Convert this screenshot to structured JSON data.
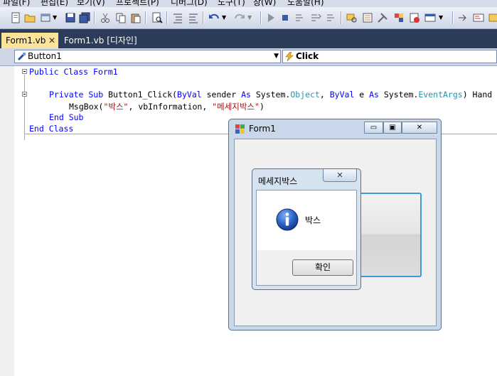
{
  "menu": {
    "items": [
      {
        "label": "파일(F)"
      },
      {
        "label": "편집(E)"
      },
      {
        "label": "보기(V)"
      },
      {
        "label": "프로젝트(P)"
      },
      {
        "label": "디버그(D)"
      },
      {
        "label": "도구(T)"
      },
      {
        "label": "창(W)"
      },
      {
        "label": "도움말(H)"
      }
    ]
  },
  "tabs": [
    {
      "label": "Form1.vb",
      "active": true
    },
    {
      "label": "Form1.vb [디자인]",
      "active": false
    }
  ],
  "dropdowns": {
    "object": "Button1",
    "event": "Click"
  },
  "code": {
    "line1": {
      "kw": "Public Class",
      "name": "Form1"
    },
    "line3": {
      "kw1": "Private Sub",
      "sig": "Button1_Click(",
      "byval1": "ByVal",
      "sender": " sender ",
      "as1": "As",
      "sys1": " System.",
      "type1": "Object",
      "comma": ", ",
      "byval2": "ByVal",
      "e": " e ",
      "as2": "As",
      "sys2": " System.",
      "type2": "EventArgs",
      "rest": ") Hand"
    },
    "line4": {
      "fn": "MsgBox(",
      "str1": "\"박스\"",
      "mid": ", vbInformation, ",
      "str2": "\"메세지박스\"",
      "end": ")"
    },
    "line5": "End Sub",
    "line6": "End Class"
  },
  "form1": {
    "title": "Form1",
    "minimize": "▭",
    "maximize": "▣",
    "close": "✕"
  },
  "msgbox": {
    "title": "메세지박스",
    "message": "박스",
    "ok_label": "확인",
    "close": "✕"
  },
  "colors": {
    "tab_active": "#fbe398",
    "tab_strip": "#2b3c59",
    "keyword": "#0000ff",
    "string": "#a31515",
    "type": "#2b91af",
    "button_focus": "#3c9ad6"
  }
}
